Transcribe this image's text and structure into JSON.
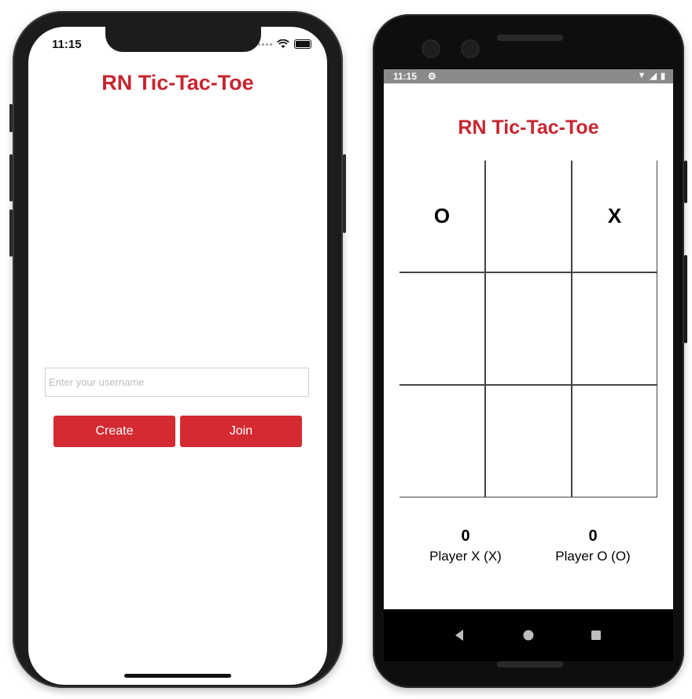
{
  "ios": {
    "status_time": "11:15",
    "title": "RN Tic-Tac-Toe",
    "username_placeholder": "Enter your username",
    "username_value": "",
    "create_label": "Create",
    "join_label": "Join"
  },
  "android": {
    "status_time": "11:15",
    "title": "RN Tic-Tac-Toe",
    "board": [
      "O",
      "",
      "X",
      "",
      "",
      "",
      "",
      "",
      ""
    ],
    "score_x": {
      "value": "0",
      "label": "Player X (X)"
    },
    "score_o": {
      "value": "0",
      "label": "Player O (O)"
    },
    "nav": [
      "back-icon",
      "home-icon",
      "recents-icon"
    ]
  },
  "colors": {
    "accent": "#c62630",
    "button": "#d42a32"
  }
}
